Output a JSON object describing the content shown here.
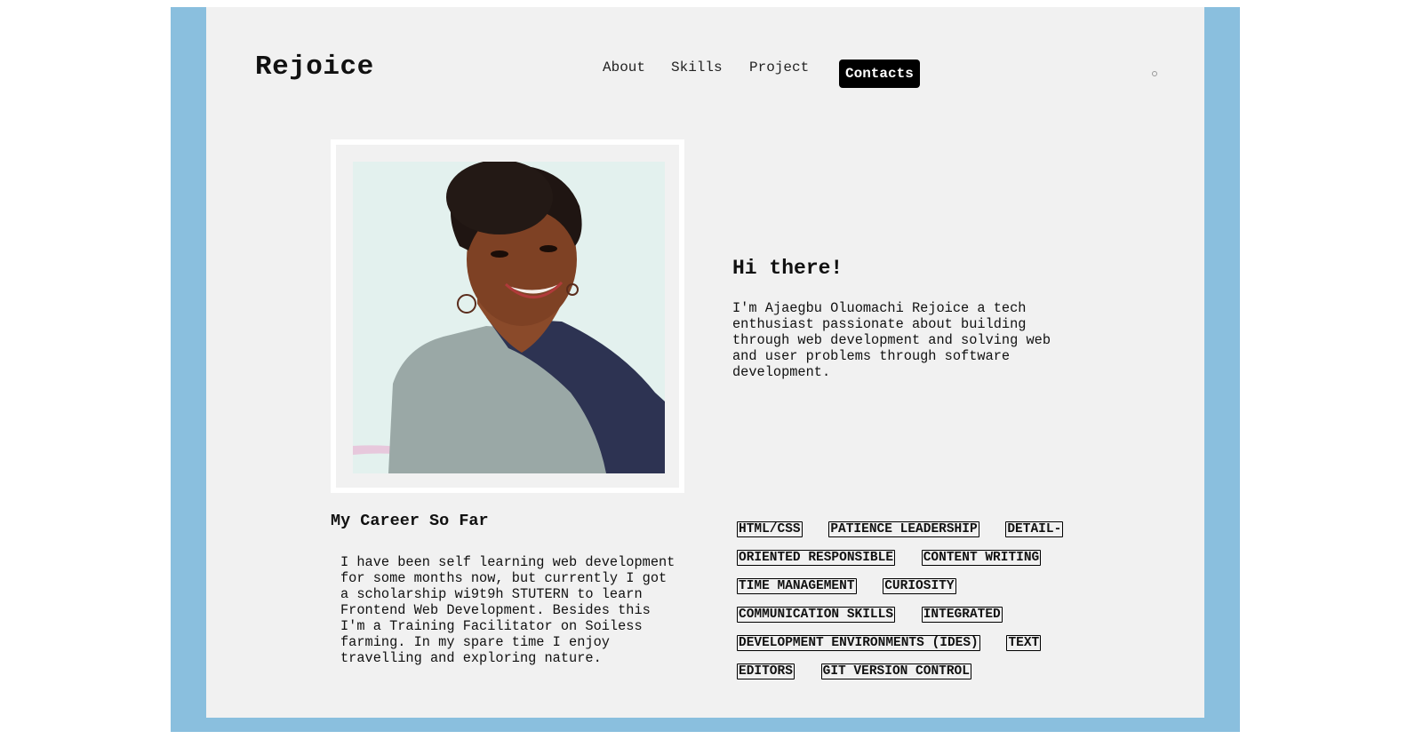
{
  "header": {
    "logo": "Rejoice",
    "nav": {
      "about": "About",
      "skills": "Skills",
      "project": "Project",
      "contacts": "Contacts"
    }
  },
  "hero": {
    "photo_alt": "Portrait of a smiling woman",
    "greeting": "Hi there!",
    "intro": "I'm Ajaegbu Oluomachi Rejoice a tech enthusiast passionate about building through web development and solving web and user problems through software development."
  },
  "career": {
    "title": "My Career So Far",
    "text": "I have been self learning web development for some months now, but currently I got a scholarship wi9t9h STUTERN to learn Frontend Web Development. Besides this I'm a Training Facilitator on Soiless farming. In my spare time I enjoy travelling and exploring nature."
  },
  "skills": [
    "HTML/CSS",
    "PATIENCE LEADERSHIP",
    "DETAIL-ORIENTED RESPONSIBLE",
    "CONTENT WRITING",
    "TIME MANAGEMENT",
    "CURIOSITY",
    "COMMUNICATION SKILLS",
    "INTEGRATED DEVELOPMENT ENVIRONMENTS (IDEs)",
    "TEXT EDITORS",
    "Git VERSION CONTROL"
  ],
  "colors": {
    "frame": "#8abfde",
    "card": "#f1f1f1",
    "contacts_bg": "#000000"
  }
}
